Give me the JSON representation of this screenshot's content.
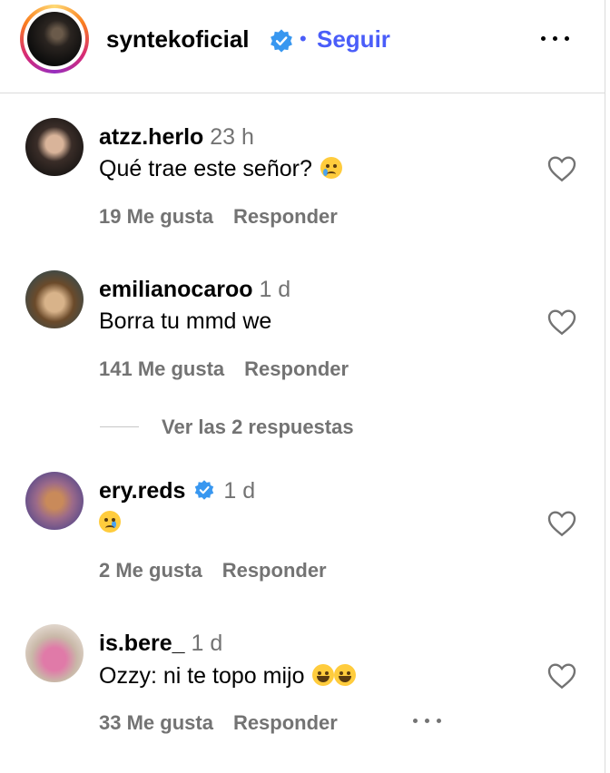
{
  "header": {
    "username": "syntekoficial",
    "separator": "•",
    "follow_label": "Seguir",
    "verified": true
  },
  "colors": {
    "accent": "#4a5df9",
    "verified": "#3897f0",
    "muted": "#737373"
  },
  "comments": [
    {
      "user": "atzz.herlo",
      "time": "23 h",
      "text": "Qué trae este señor?",
      "emoji": [
        "loudly-crying"
      ],
      "likes": "19 Me gusta",
      "reply": "Responder",
      "verified": false
    },
    {
      "user": "emilianocaroo",
      "time": "1 d",
      "text": "Borra tu mmd we",
      "emoji": [],
      "likes": "141 Me gusta",
      "reply": "Responder",
      "verified": false
    },
    {
      "user": "ery.reds",
      "time": "1 d",
      "text": "",
      "emoji": [
        "crying"
      ],
      "likes": "2 Me gusta",
      "reply": "Responder",
      "verified": true
    },
    {
      "user": "is.bere_",
      "time": "1 d",
      "text": "Ozzy: ni te topo mijo",
      "emoji": [
        "tears-of-joy",
        "tears-of-joy"
      ],
      "likes": "33 Me gusta",
      "reply": "Responder",
      "verified": false
    }
  ],
  "view_replies": "Ver las 2 respuestas",
  "icons": [
    "more-icon",
    "verified-badge-icon",
    "heart-icon",
    "emoji-icon"
  ]
}
